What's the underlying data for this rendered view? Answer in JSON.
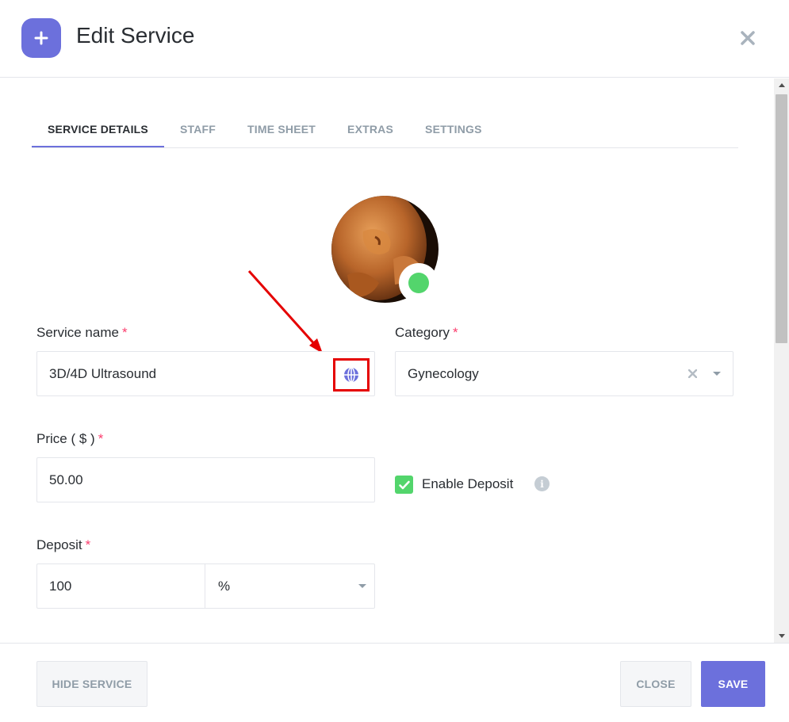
{
  "header": {
    "title": "Edit Service",
    "icon": "plus-icon",
    "close_icon": "close-icon",
    "accent_color": "#6c70dc"
  },
  "tabs": [
    {
      "label": "SERVICE DETAILS",
      "active": true
    },
    {
      "label": "STAFF",
      "active": false
    },
    {
      "label": "TIME SHEET",
      "active": false
    },
    {
      "label": "EXTRAS",
      "active": false
    },
    {
      "label": "SETTINGS",
      "active": false
    }
  ],
  "avatar": {
    "status": "active",
    "status_color": "#53d56c"
  },
  "form": {
    "service_name": {
      "label": "Service name",
      "required_mark": "*",
      "value": "3D/4D Ultrasound",
      "translate_icon": "globe-icon"
    },
    "category": {
      "label": "Category",
      "required_mark": "*",
      "value": "Gynecology",
      "clear_icon": "clear-icon",
      "caret_icon": "chevron-down-icon"
    },
    "price": {
      "label": "Price ( $ )",
      "required_mark": "*",
      "value": "50.00"
    },
    "enable_deposit": {
      "label": "Enable Deposit",
      "checked": true,
      "info_icon": "info-icon",
      "info_glyph": "i"
    },
    "deposit": {
      "label": "Deposit",
      "required_mark": "*",
      "value": "100",
      "unit": "%"
    }
  },
  "footer": {
    "hide_label": "HIDE SERVICE",
    "close_label": "CLOSE",
    "save_label": "SAVE"
  }
}
